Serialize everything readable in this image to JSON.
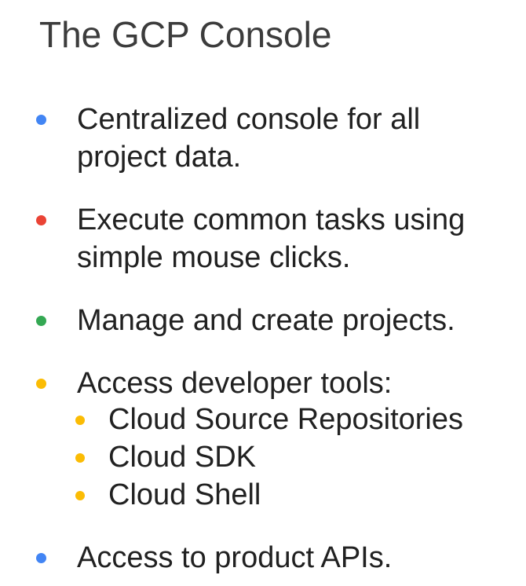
{
  "slide": {
    "title": "The GCP Console",
    "bullets": [
      {
        "text_lines": [
          "Centralized console for all",
          "project data."
        ],
        "color": "#4285F4"
      },
      {
        "text_lines": [
          "Execute common tasks using",
          "simple mouse clicks."
        ],
        "color": "#EA4335"
      },
      {
        "text_lines": [
          "Manage and create projects."
        ],
        "color": "#34A853"
      },
      {
        "text_lines": [
          "Access developer tools:"
        ],
        "color": "#FBBC04",
        "sub_bullets": [
          {
            "text": "Cloud Source Repositories",
            "color": "#FBBC04"
          },
          {
            "text": "Cloud SDK",
            "color": "#FBBC04"
          },
          {
            "text": "Cloud Shell",
            "color": "#FBBC04"
          }
        ]
      },
      {
        "text_lines": [
          "Access to product APIs."
        ],
        "color": "#4285F4"
      }
    ]
  }
}
